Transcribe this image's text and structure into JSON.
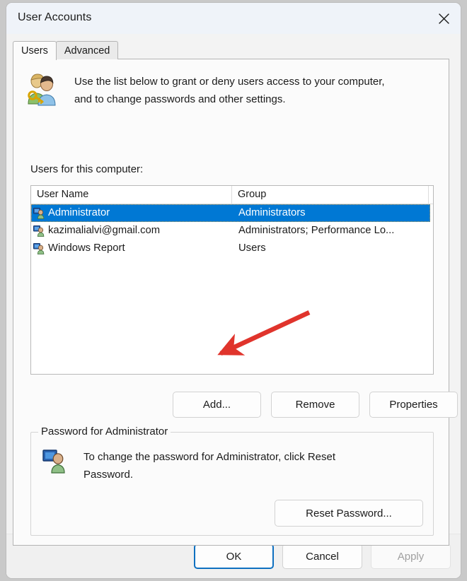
{
  "window": {
    "title": "User Accounts",
    "close_icon": "close-icon"
  },
  "tabs": [
    {
      "label": "Users",
      "active": true
    },
    {
      "label": "Advanced",
      "active": false
    }
  ],
  "info": {
    "icon": "users-with-key-icon",
    "line1": "Use the list below to grant or deny users access to your computer,",
    "line2": "and to change passwords and other settings."
  },
  "list": {
    "label": "Users for this computer:",
    "columns": [
      "User Name",
      "Group"
    ],
    "rows": [
      {
        "icon": "user-account-icon",
        "user_name": "Administrator",
        "group": "Administrators",
        "selected": true
      },
      {
        "icon": "user-account-icon",
        "user_name": "kazimalialvi@gmail.com",
        "group": "Administrators; Performance Lo...",
        "selected": false
      },
      {
        "icon": "user-account-icon",
        "user_name": "Windows Report",
        "group": "Users",
        "selected": false
      }
    ]
  },
  "row_buttons": {
    "add": "Add...",
    "remove": "Remove",
    "properties": "Properties"
  },
  "password_group": {
    "legend": "Password for Administrator",
    "icon": "user-account-icon",
    "line1": "To change the password for Administrator, click Reset",
    "line2": "Password.",
    "reset_button": "Reset Password..."
  },
  "footer": {
    "ok": "OK",
    "cancel": "Cancel",
    "apply": "Apply",
    "apply_disabled": true
  },
  "annotation": {
    "type": "arrow",
    "color": "#e0342c",
    "points_to": "Add... button"
  },
  "colors": {
    "selection": "#0078d4",
    "titlebar": "#eff3f9",
    "accent": "#0e70c0",
    "annotation": "#e0342c"
  }
}
